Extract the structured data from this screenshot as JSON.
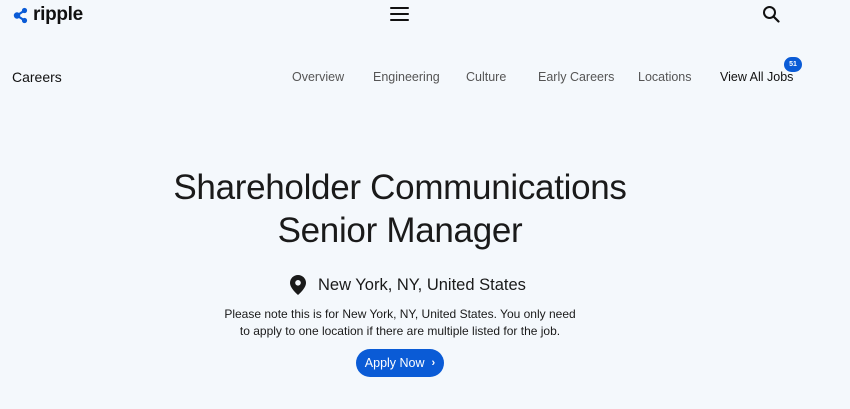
{
  "header": {
    "logo_text": "ripple",
    "menu_icon": "hamburger-icon",
    "search_icon": "search-icon"
  },
  "subnav": {
    "section_title": "Careers",
    "links": [
      {
        "label": "Overview"
      },
      {
        "label": "Engineering"
      },
      {
        "label": "Culture"
      },
      {
        "label": "Early Careers"
      },
      {
        "label": "Locations"
      },
      {
        "label": "View All Jobs"
      }
    ],
    "jobs_count": "51"
  },
  "job": {
    "title_line1": "Shareholder Communications",
    "title_line2": "Senior Manager",
    "location": "New York, NY, United States",
    "note_line1": "Please note this is for New York, NY, United States. You only need",
    "note_line2": "to apply to one location if there are multiple listed for the job.",
    "apply_label": "Apply Now",
    "location_icon": "map-pin-icon",
    "apply_icon": "chevron-right-icon"
  },
  "colors": {
    "background": "#f4f8fc",
    "accent": "#0a5bd6",
    "text": "#1a1a1a"
  }
}
